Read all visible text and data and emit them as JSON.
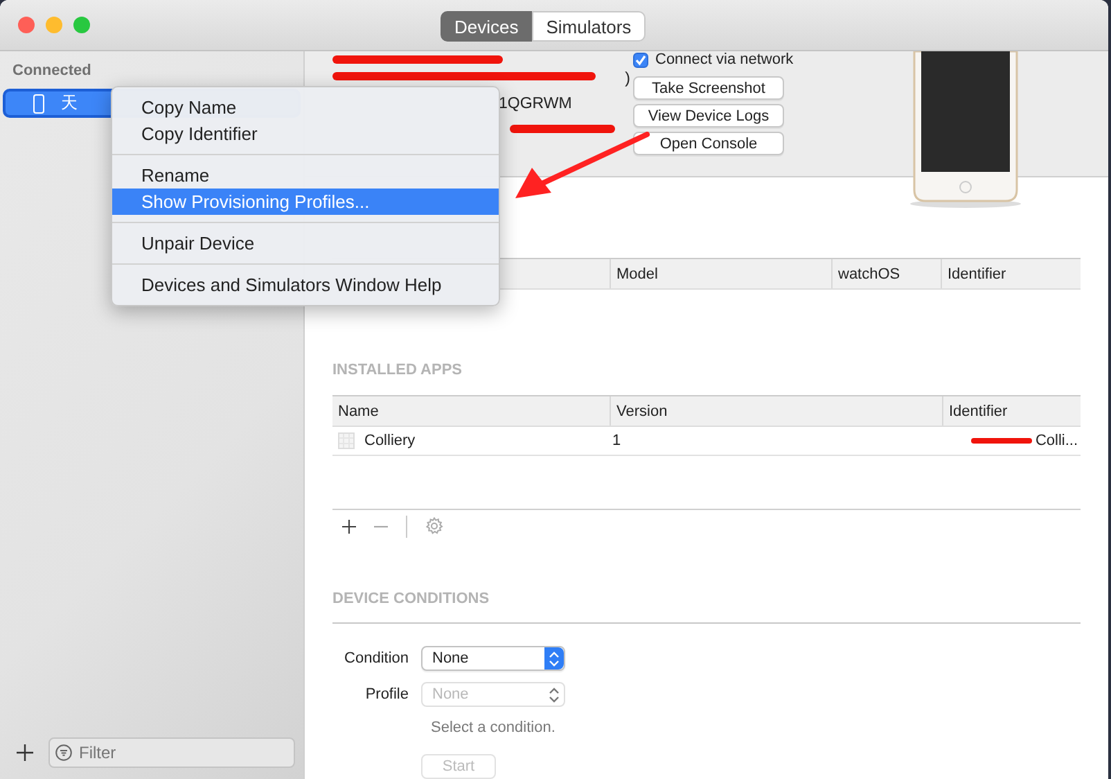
{
  "window": {
    "traffic_lights": [
      {
        "color": "#fe5f57"
      },
      {
        "color": "#febc2e"
      },
      {
        "color": "#28c840"
      }
    ]
  },
  "tabs": [
    {
      "label": "Devices",
      "selected": true
    },
    {
      "label": "Simulators",
      "selected": false
    }
  ],
  "sidebar": {
    "section": "Connected",
    "devices": [
      {
        "name": "天",
        "selected": true
      }
    ],
    "filter": {
      "placeholder": "Filter"
    }
  },
  "context_menu": {
    "groups": [
      [
        {
          "label": "Copy Name",
          "selected": false
        },
        {
          "label": "Copy Identifier",
          "selected": false
        }
      ],
      [
        {
          "label": "Rename",
          "selected": false
        },
        {
          "label": "Show Provisioning Profiles...",
          "selected": true
        }
      ],
      [
        {
          "label": "Unpair Device",
          "selected": false
        }
      ],
      [
        {
          "label": "Devices and Simulators Window Help",
          "selected": false
        }
      ]
    ]
  },
  "device_details": [
    ")",
    "1QGRWM"
  ],
  "connect_via_network": {
    "label": "Connect via network",
    "checked": true
  },
  "actions": [
    "Take Screenshot",
    "View Device Logs",
    "Open Console"
  ],
  "paired_watches": {
    "columns": [
      "Model",
      "watchOS",
      "Identifier"
    ]
  },
  "installed_apps": {
    "title": "INSTALLED APPS",
    "columns": [
      "Name",
      "Version",
      "Identifier"
    ],
    "rows": [
      {
        "name": "Colliery",
        "version": "1",
        "identifier": "Colli..."
      }
    ]
  },
  "device_conditions": {
    "title": "DEVICE CONDITIONS",
    "condition": {
      "label": "Condition",
      "value": "None",
      "disabled": false
    },
    "profile": {
      "label": "Profile",
      "placeholder": "None",
      "disabled": true
    },
    "hint": "Select a condition.",
    "start_button": {
      "label": "Start",
      "disabled": true
    }
  }
}
